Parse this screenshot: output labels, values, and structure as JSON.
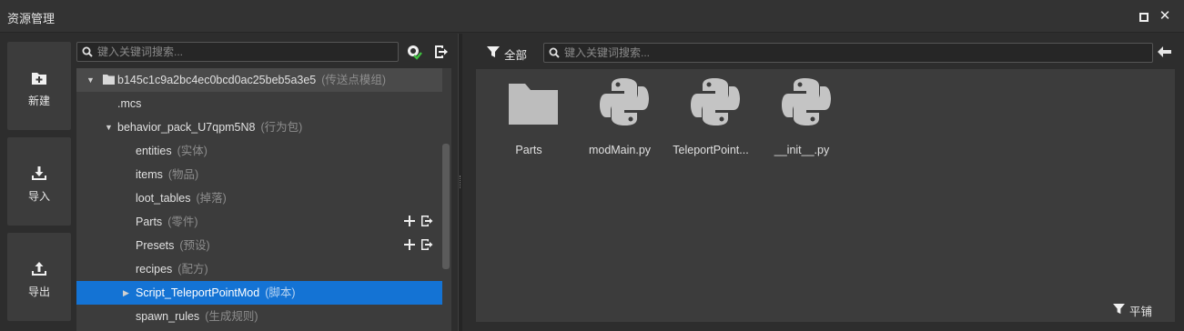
{
  "window": {
    "title": "资源管理"
  },
  "sidebar": {
    "buttons": [
      {
        "label": "新建",
        "icon": "new-folder-icon"
      },
      {
        "label": "导入",
        "icon": "import-icon"
      },
      {
        "label": "导出",
        "icon": "export-icon"
      }
    ]
  },
  "left_search": {
    "placeholder": "键入关键词搜索..."
  },
  "tree": {
    "root": {
      "label": "b145c1c9a2bc4ec0bcd0ac25beb5a3e5",
      "hint": "(传送点模组)"
    },
    "items": [
      {
        "label": ".mcs",
        "hint": ""
      },
      {
        "label": "behavior_pack_U7qpm5N8",
        "hint": "(行为包)"
      },
      {
        "label": "entities",
        "hint": "(实体)"
      },
      {
        "label": "items",
        "hint": "(物品)"
      },
      {
        "label": "loot_tables",
        "hint": "(掉落)"
      },
      {
        "label": "Parts",
        "hint": "(零件)"
      },
      {
        "label": "Presets",
        "hint": "(预设)"
      },
      {
        "label": "recipes",
        "hint": "(配方)"
      },
      {
        "label": "Script_TeleportPointMod",
        "hint": "(脚本)"
      },
      {
        "label": "spawn_rules",
        "hint": "(生成规则)"
      }
    ]
  },
  "right": {
    "filter_label": "全部",
    "search_placeholder": "键入关键词搜索...",
    "files": [
      {
        "name": "Parts",
        "icon": "folder-icon"
      },
      {
        "name": "modMain.py",
        "icon": "python-icon"
      },
      {
        "name": "TeleportPoint...",
        "icon": "python-icon"
      },
      {
        "name": "__init__.py",
        "icon": "python-icon"
      }
    ],
    "flatten_label": "平铺"
  },
  "colors": {
    "accent": "#1473d4",
    "panel": "#3c3c3c",
    "background": "#2d2d2d"
  }
}
